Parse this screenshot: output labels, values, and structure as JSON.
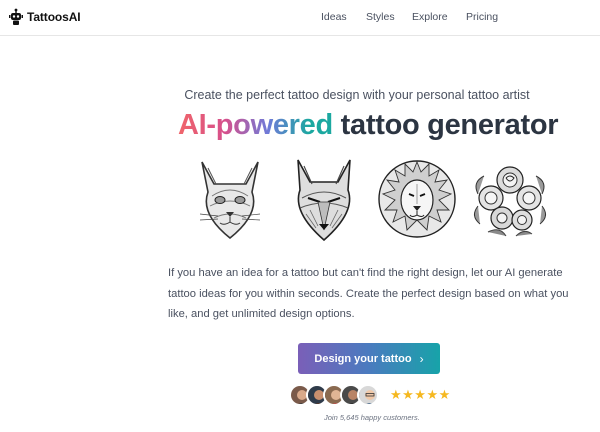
{
  "header": {
    "brand": "TattoosAI",
    "nav": [
      "Ideas",
      "Styles",
      "Explore",
      "Pricing"
    ]
  },
  "hero": {
    "tagline": "Create the perfect tattoo design with your personal tattoo artist",
    "headline_highlight": "AI-powered",
    "headline_rest": "tattoo generator",
    "gallery": [
      "cat-tattoo",
      "wolf-tattoo",
      "lion-tattoo",
      "roses-tattoo"
    ],
    "description": "If you have an idea for a tattoo but can't find the right design, let our AI generate tattoo ideas for you within seconds. Create the perfect design based on what you like, and get unlimited design options.",
    "cta_label": "Design your tattoo",
    "cta_icon": "chevron-right-icon",
    "stars": "★★★★★",
    "rating": 5,
    "social_proof": "Join 5,645 happy customers."
  },
  "colors": {
    "gradient_start": "#f0656a",
    "gradient_mid": "#6f7ad8",
    "gradient_end": "#1ba8a0",
    "cta_start": "#7a5fb8",
    "cta_end": "#17a3a9",
    "star": "#f5b820"
  }
}
